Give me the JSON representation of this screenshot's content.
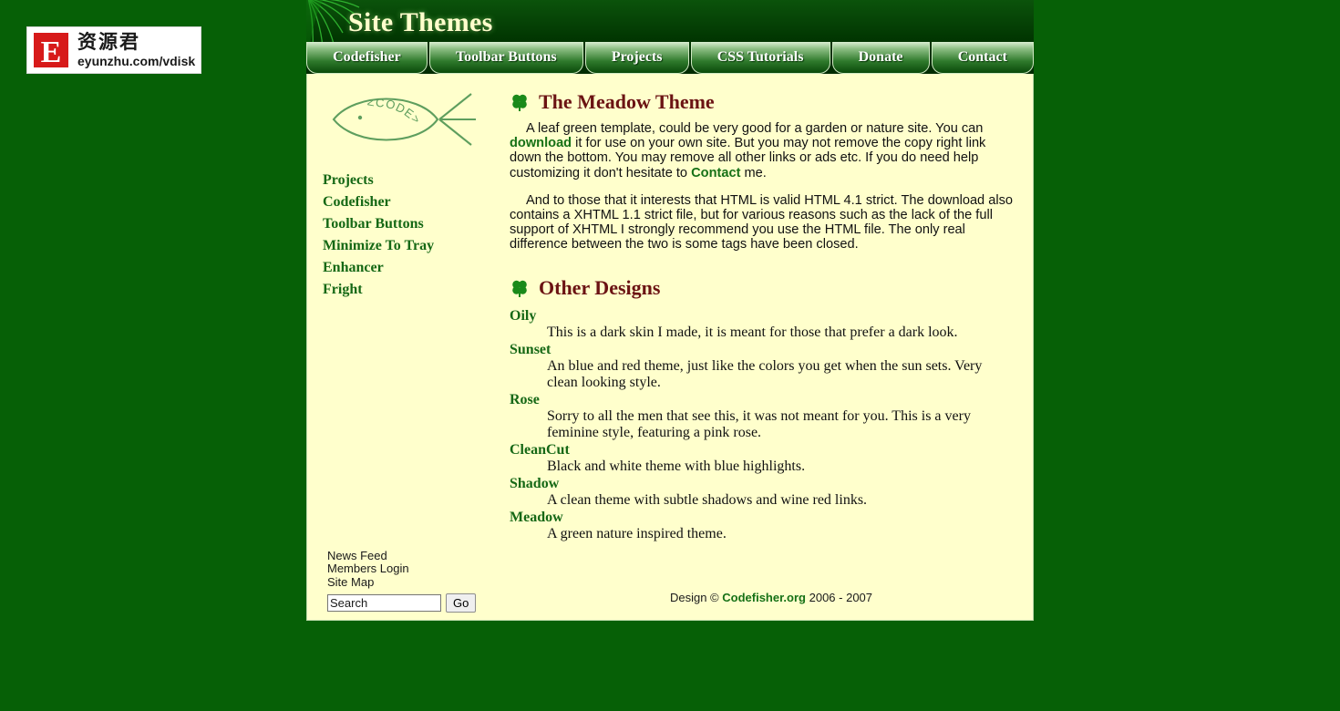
{
  "watermark": {
    "logo_letter": "E",
    "chinese": "资源君",
    "url": "eyunzhu.com/vdisk"
  },
  "header": {
    "title": "Site Themes",
    "leaf_icon": "fern-leaf-icon",
    "tabs": [
      {
        "label": "Codefisher"
      },
      {
        "label": "Toolbar Buttons"
      },
      {
        "label": "Projects"
      },
      {
        "label": "CSS Tutorials"
      },
      {
        "label": "Donate"
      },
      {
        "label": "Contact"
      }
    ]
  },
  "sidebar": {
    "logo_alt": "codefisher-fish-logo",
    "logo_text": "<CODE>",
    "nav": [
      {
        "label": "Projects"
      },
      {
        "label": "Codefisher"
      },
      {
        "label": "Toolbar Buttons"
      },
      {
        "label": "Minimize To Tray Enhancer"
      },
      {
        "label": "Fright"
      }
    ],
    "bottom_links": [
      {
        "label": "News Feed"
      },
      {
        "label": "Members Login"
      },
      {
        "label": "Site Map"
      }
    ],
    "search": {
      "value": "Search",
      "placeholder": "Search",
      "button_label": "Go"
    }
  },
  "main": {
    "heading1": "The Meadow Theme",
    "heading2": "Other Designs",
    "clover_icon": "clover-icon",
    "paragraph1": {
      "part1": "A leaf green template, could be very good for a garden or nature site. You can ",
      "link1": "download",
      "part2": " it for use on your own site. But you may not remove the copy right link down the bottom. You may remove all other links or ads etc. If you do need help customizing it don't hesitate to ",
      "link2": "Contact",
      "part3": " me."
    },
    "paragraph2": "And to those that it interests that HTML is valid HTML 4.1 strict. The download also contains a XHTML 1.1 strict file, but for various reasons such as the lack of the full support of XHTML I strongly recommend you use the HTML file. The only real difference between the two is some tags have been closed.",
    "designs": [
      {
        "term": "Oily",
        "description": "This is a dark skin I made, it is meant for those that prefer a dark look."
      },
      {
        "term": "Sunset",
        "description": "An blue and red theme, just like the colors you get when the sun sets. Very clean looking style."
      },
      {
        "term": "Rose",
        "description": "Sorry to all the men that see this, it was not meant for you. This is a very feminine style, featuring a pink rose."
      },
      {
        "term": "CleanCut",
        "description": "Black and white theme with blue highlights."
      },
      {
        "term": "Shadow",
        "description": "A clean theme with subtle shadows and wine red links."
      },
      {
        "term": "Meadow",
        "description": "A green nature inspired theme."
      }
    ]
  },
  "footer": {
    "prefix": "Design © ",
    "link": "Codefisher.org",
    "suffix": " 2006 - 2007"
  },
  "colors": {
    "page_background": "#066006",
    "content_background": "#ffffcc",
    "heading": "#6b1313",
    "link_green": "#167116",
    "header_dark": "#013d01"
  }
}
